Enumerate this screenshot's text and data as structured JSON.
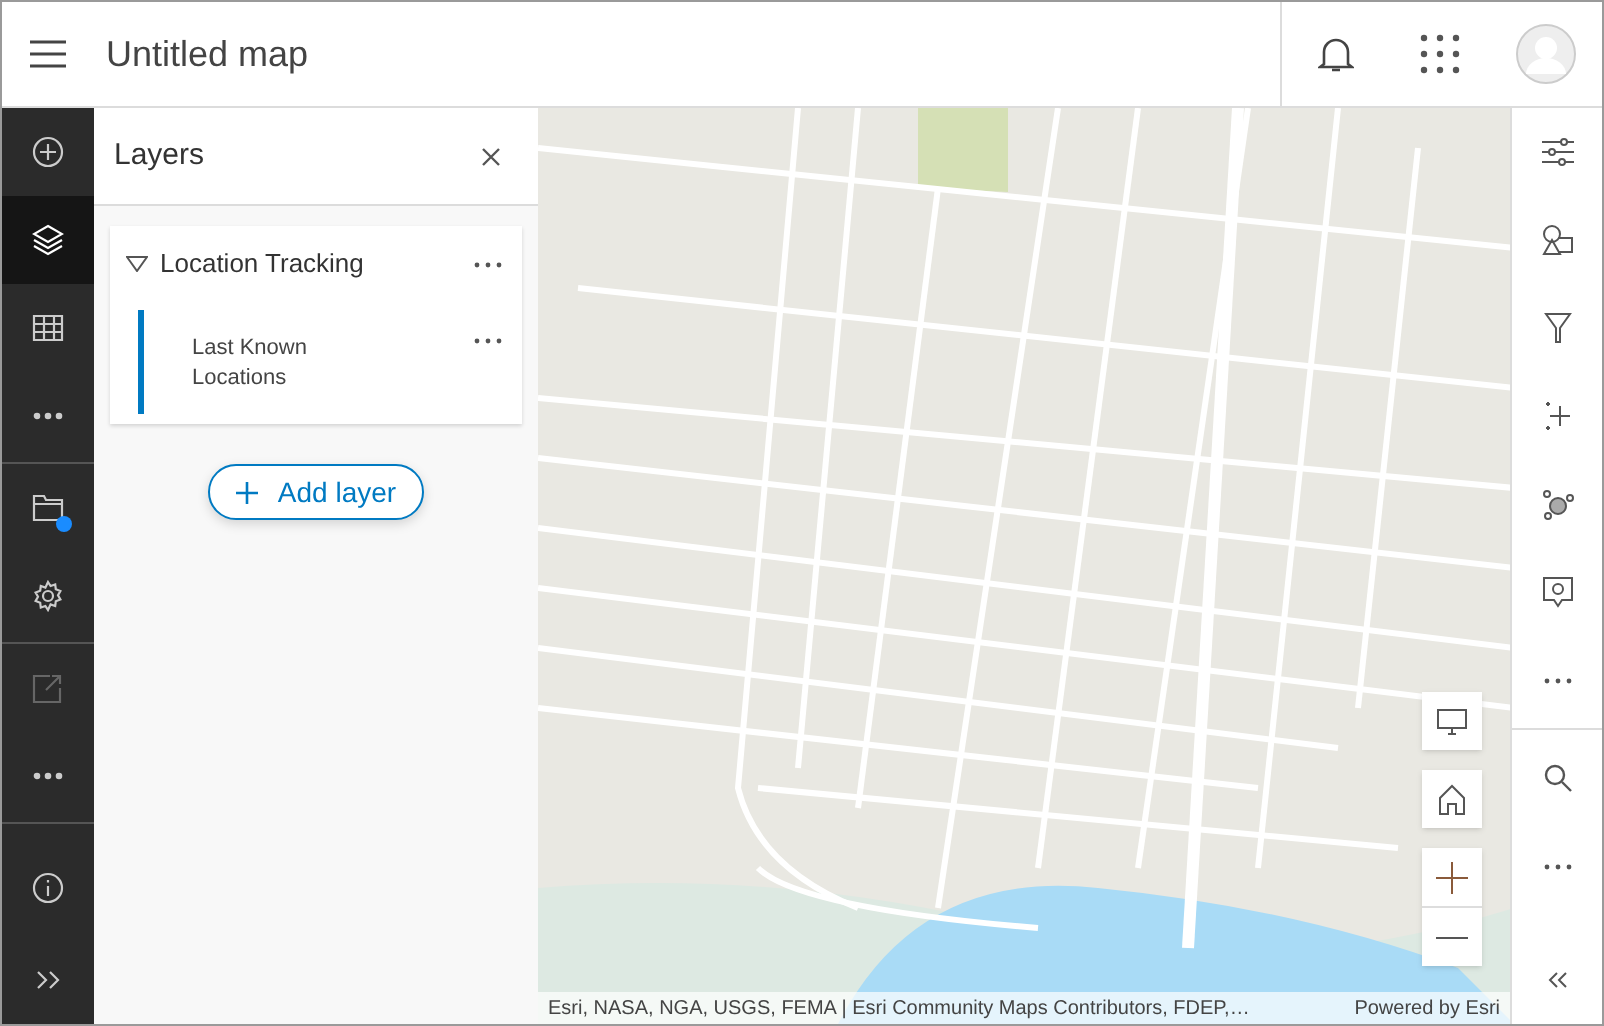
{
  "header": {
    "title": "Untitled map"
  },
  "left_rail": {
    "groups": [
      [
        {
          "selected": false,
          "disabled": false,
          "notification": false
        },
        {
          "selected": true,
          "disabled": false,
          "notification": false
        },
        {
          "selected": false,
          "disabled": false,
          "notification": false
        },
        {
          "selected": false,
          "disabled": false,
          "notification": false
        }
      ],
      [
        {
          "selected": false,
          "disabled": false,
          "notification": true
        },
        {
          "selected": false,
          "disabled": false,
          "notification": false
        }
      ],
      [
        {
          "selected": false,
          "disabled": true,
          "notification": false
        },
        {
          "selected": false,
          "disabled": false,
          "notification": false
        }
      ],
      [
        {
          "selected": false,
          "disabled": false,
          "notification": false
        },
        {
          "selected": false,
          "disabled": false,
          "notification": false
        }
      ]
    ]
  },
  "layers_panel": {
    "title": "Layers",
    "layers": [
      {
        "title": "Location Tracking",
        "expanded": true,
        "children": [
          {
            "title": "Last Known Locations",
            "selected": true
          }
        ]
      }
    ],
    "add_button": "Add layer"
  },
  "map": {
    "attribution": "Esri, NASA, NGA, USGS, FEMA | Esri Community Maps Contributors, FDEP,…",
    "powered_by": "Powered by Esri"
  }
}
